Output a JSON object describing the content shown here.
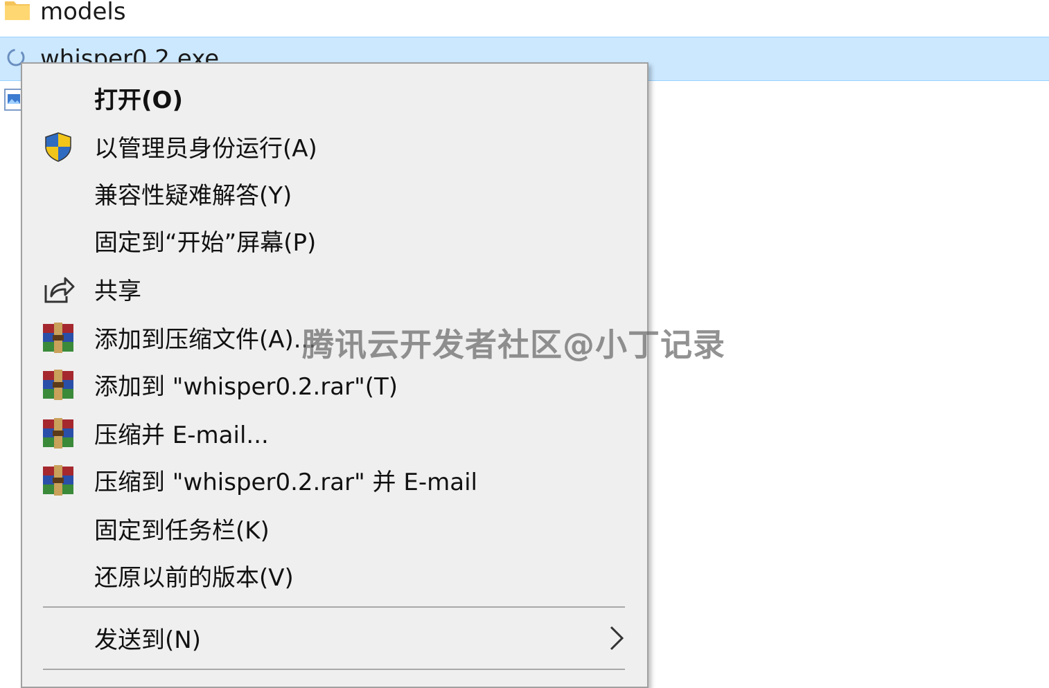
{
  "explorer": {
    "files": [
      {
        "name": "models",
        "icon": "folder-icon"
      },
      {
        "name": "whisper0.2.exe",
        "icon": "exe-icon",
        "selected": true
      },
      {
        "name": "",
        "icon": "image-file-icon"
      }
    ]
  },
  "context_menu": {
    "items": [
      {
        "label": "打开(O)",
        "icon": "",
        "bold": true
      },
      {
        "label": "以管理员身份运行(A)",
        "icon": "uac-shield-icon"
      },
      {
        "label": "兼容性疑难解答(Y)",
        "icon": ""
      },
      {
        "label": "固定到“开始”屏幕(P)",
        "icon": ""
      },
      {
        "label": "共享",
        "icon": "share-icon"
      },
      {
        "label": "添加到压缩文件(A)...",
        "icon": "winrar-icon"
      },
      {
        "label": "添加到 \"whisper0.2.rar\"(T)",
        "icon": "winrar-icon"
      },
      {
        "label": "压缩并 E-mail...",
        "icon": "winrar-icon"
      },
      {
        "label": "压缩到 \"whisper0.2.rar\" 并 E-mail",
        "icon": "winrar-icon"
      },
      {
        "label": "固定到任务栏(K)",
        "icon": ""
      },
      {
        "label": "还原以前的版本(V)",
        "icon": ""
      },
      {
        "label": "发送到(N)",
        "icon": "",
        "submenu": true
      }
    ]
  },
  "watermark": "腾讯云开发者社区@小丁记录",
  "colors": {
    "selection": "#cce8ff",
    "menu_bg": "#efefef",
    "winrar_red": "#a5282f",
    "winrar_blue": "#2a4fa8",
    "winrar_green": "#3a8a3a",
    "shield_blue": "#2f6bc1",
    "shield_yellow": "#f2c51a"
  }
}
